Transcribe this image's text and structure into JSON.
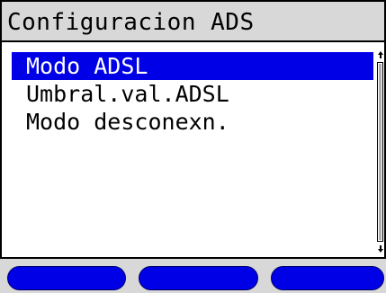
{
  "header": {
    "title": "Configuracion ADS"
  },
  "menu": {
    "selected_index": 0,
    "items": [
      {
        "label": "Modo ADSL"
      },
      {
        "label": "Umbral.val.ADSL"
      },
      {
        "label": "Modo desconexn."
      }
    ]
  },
  "scrollbar": {
    "up_icon": "arrow-up-icon",
    "down_icon": "arrow-down-icon"
  },
  "softkeys": [
    {
      "label": ""
    },
    {
      "label": ""
    },
    {
      "label": ""
    }
  ],
  "colors": {
    "accent": "#0000e6",
    "title_bar": "#d8d8d8",
    "background": "#ffffff",
    "text": "#000000",
    "selected_text": "#ffffff"
  }
}
